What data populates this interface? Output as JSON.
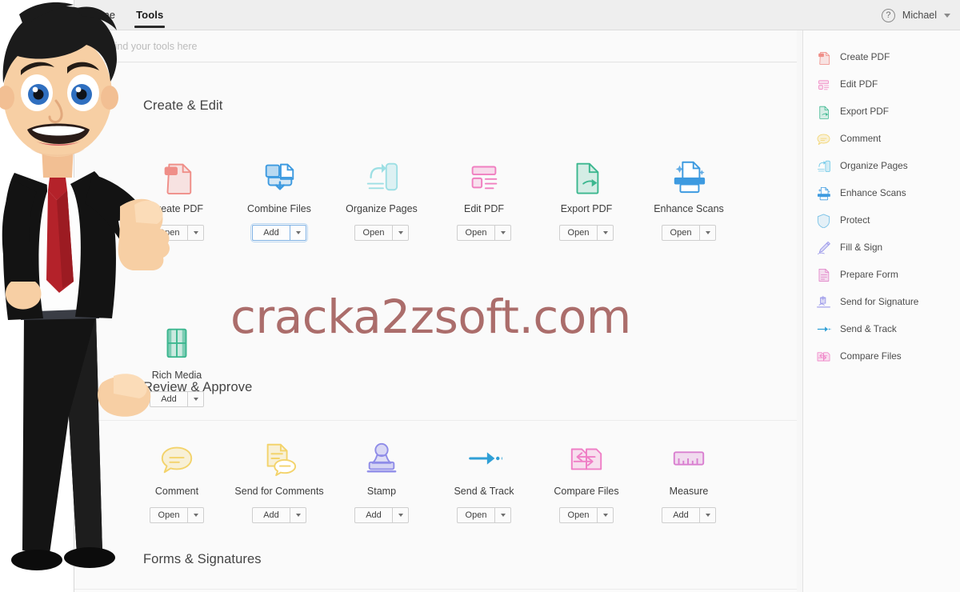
{
  "window": {
    "menu_tabs": [
      {
        "label": "Home",
        "active": false
      },
      {
        "label": "Tools",
        "active": true
      }
    ],
    "help_glyph": "?",
    "user_name": "Michael"
  },
  "search": {
    "placeholder": "Find your tools here",
    "value": "",
    "icon": "search-icon"
  },
  "watermark": {
    "text": "cracka2zsoft.com",
    "color": "#a5625f"
  },
  "sections": [
    {
      "title": "Create & Edit",
      "tools": [
        {
          "label": "Create PDF",
          "icon": "create-pdf-icon",
          "action": "Open",
          "highlight": false,
          "color": "#ef8e88"
        },
        {
          "label": "Combine Files",
          "icon": "combine-files-icon",
          "action": "Add",
          "highlight": true,
          "color": "#3d9ae0"
        },
        {
          "label": "Organize Pages",
          "icon": "organize-pages-icon",
          "action": "Open",
          "highlight": false,
          "color": "#9ddfe4"
        },
        {
          "label": "Edit PDF",
          "icon": "edit-pdf-icon",
          "action": "Open",
          "highlight": false,
          "color": "#f07fc0"
        },
        {
          "label": "Export PDF",
          "icon": "export-pdf-icon",
          "action": "Open",
          "highlight": false,
          "color": "#3cb78f"
        },
        {
          "label": "Enhance Scans",
          "icon": "enhance-scans-icon",
          "action": "Open",
          "highlight": false,
          "color": "#3d9ae0"
        },
        {
          "label": "Rich Media",
          "icon": "rich-media-icon",
          "action": "Add",
          "highlight": false,
          "color": "#3cb78f"
        }
      ]
    },
    {
      "title": "Review & Approve",
      "tools": [
        {
          "label": "Comment",
          "icon": "comment-icon",
          "action": "Open",
          "highlight": false,
          "color": "#f3d36b"
        },
        {
          "label": "Send for Comments",
          "icon": "send-comments-icon",
          "action": "Add",
          "highlight": false,
          "color": "#f3d36b"
        },
        {
          "label": "Stamp",
          "icon": "stamp-icon",
          "action": "Add",
          "highlight": false,
          "color": "#8f8ce8"
        },
        {
          "label": "Send & Track",
          "icon": "send-track-icon",
          "action": "Open",
          "highlight": false,
          "color": "#2f9fd6"
        },
        {
          "label": "Compare Files",
          "icon": "compare-files-icon",
          "action": "Open",
          "highlight": false,
          "color": "#ef7fc6"
        },
        {
          "label": "Measure",
          "icon": "measure-icon",
          "action": "Add",
          "highlight": false,
          "color": "#d97fd0"
        }
      ]
    },
    {
      "title": "Forms & Signatures",
      "tools": []
    }
  ],
  "rail": {
    "items": [
      {
        "label": "Create PDF",
        "icon": "create-pdf-icon",
        "color": "#ef8e88"
      },
      {
        "label": "Edit PDF",
        "icon": "edit-pdf-icon",
        "color": "#f07fc0"
      },
      {
        "label": "Export PDF",
        "icon": "export-pdf-icon",
        "color": "#3cb78f"
      },
      {
        "label": "Comment",
        "icon": "comment-icon",
        "color": "#f3d36b"
      },
      {
        "label": "Organize Pages",
        "icon": "organize-pages-icon",
        "color": "#6fc9e8"
      },
      {
        "label": "Enhance Scans",
        "icon": "enhance-scans-icon",
        "color": "#3d9ae0"
      },
      {
        "label": "Protect",
        "icon": "protect-icon",
        "color": "#7fc4e8"
      },
      {
        "label": "Fill & Sign",
        "icon": "fill-sign-icon",
        "color": "#8f8ce8"
      },
      {
        "label": "Prepare Form",
        "icon": "prepare-form-icon",
        "color": "#e07fc6"
      },
      {
        "label": "Send for Signature",
        "icon": "send-for-signature-icon",
        "color": "#8f8ce8"
      },
      {
        "label": "Send & Track",
        "icon": "send-track-icon",
        "color": "#2f9fd6"
      },
      {
        "label": "Compare Files",
        "icon": "compare-files-icon",
        "color": "#ef7fc6"
      }
    ]
  },
  "mascot": {
    "description": "cartoon-businessman-pointing",
    "hair_color": "#1b1b1b",
    "suit_color": "#131313",
    "tie_color": "#b4222a",
    "skin_color": "#f7cfa4"
  }
}
